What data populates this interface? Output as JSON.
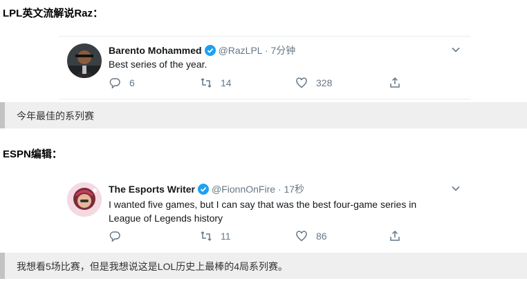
{
  "sections": [
    {
      "heading": "LPL英文流解说Raz：",
      "tweet": {
        "name": "Barento Mohammed",
        "handle": "@RazLPL",
        "time": "· 7分钟",
        "text": "Best series of the year.",
        "replies": "6",
        "retweets": "14",
        "likes": "328"
      },
      "translation": "今年最佳的系列赛"
    },
    {
      "heading": "ESPN编辑：",
      "tweet": {
        "name": "The Esports Writer",
        "handle": "@FionnOnFire",
        "time": "· 17秒",
        "text": "I wanted five games, but I can say that was the best four-game series in League of Legends history",
        "replies": "",
        "retweets": "11",
        "likes": "86"
      },
      "translation": "我想看5场比赛，但是我想说这是LOL历史上最棒的4局系列赛。"
    }
  ],
  "colors": {
    "verified": "#1da1f2",
    "action_gray": "#657786",
    "quote_bg": "#efefef",
    "quote_border": "#c3c3c3"
  },
  "icons": [
    "verified-badge-icon",
    "chevron-down-icon",
    "reply-icon",
    "retweet-icon",
    "like-icon",
    "share-icon"
  ]
}
